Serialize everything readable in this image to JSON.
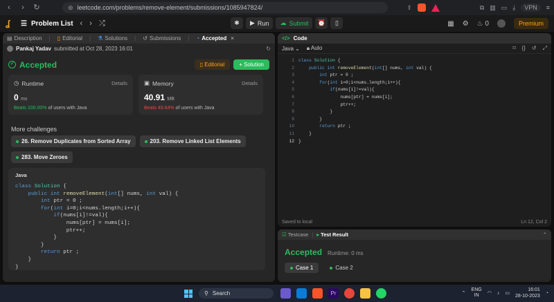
{
  "browser": {
    "url": "leetcode.com/problems/remove-element/submissions/1085947824/",
    "vpn_label": "VPN"
  },
  "header": {
    "title": "Problem List",
    "run_label": "Run",
    "submit_label": "Submit",
    "streak_count": "0",
    "premium_label": "Premium"
  },
  "left": {
    "tabs": [
      "Description",
      "Editorial",
      "Solutions",
      "Submissions",
      "Accepted"
    ],
    "submitter_name": "Pankaj Yadav",
    "submitted_text": "submitted at Oct 28, 2023 16:01",
    "status": "Accepted",
    "editorial_btn": "Editorial",
    "solution_btn": "+ Solution",
    "runtime": {
      "title": "Runtime",
      "details": "Details",
      "value": "0",
      "unit": "ms",
      "beats_pct": "Beats 100.00%",
      "beats_suffix": "of users with Java"
    },
    "memory": {
      "title": "Memory",
      "details": "Details",
      "value": "40.91",
      "unit": "MB",
      "beats_pct": "Beats 49.64%",
      "beats_suffix": "of users with Java"
    },
    "more_title": "More challenges",
    "challenges": [
      "26. Remove Duplicates from Sorted Array",
      "203. Remove Linked List Elements",
      "283. Move Zeroes"
    ],
    "code_lang": "Java"
  },
  "code_lines": [
    "class Solution {",
    "    public int removeElement(int[] nums, int val) {",
    "        int ptr = 0 ;",
    "        for(int i=0;i<nums.length;i++){",
    "            if(nums[i]!=val){",
    "                nums[ptr] = nums[i];",
    "                ptr++;",
    "            }",
    "        }",
    "        return ptr ;",
    "    }",
    "}"
  ],
  "right": {
    "title": "Code",
    "lang": "Java",
    "mode": "Auto",
    "saved": "Saved to local",
    "cursor": "Ln 12, Col 2"
  },
  "test": {
    "tabs": [
      "Testcase",
      "Test Result"
    ],
    "status": "Accepted",
    "runtime": "Runtime: 0 ms",
    "cases": [
      "Case 1",
      "Case 2"
    ]
  },
  "taskbar": {
    "search_label": "Search",
    "lang_top": "ENG",
    "lang_bottom": "IN",
    "time": "16:01",
    "date": "28-10-2023"
  }
}
